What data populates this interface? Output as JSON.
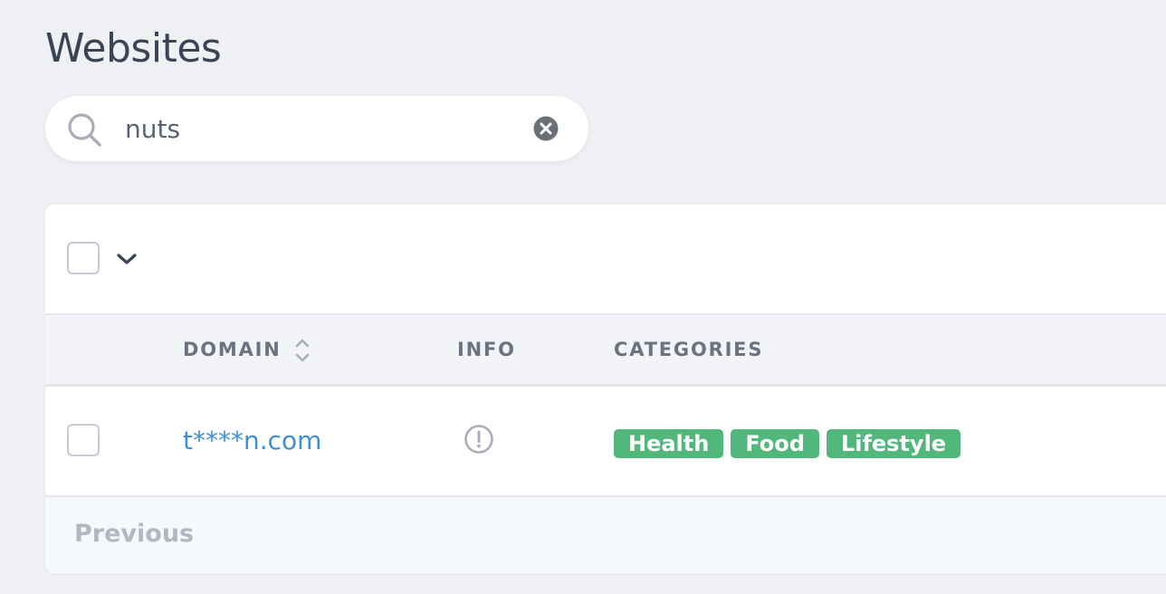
{
  "page": {
    "title": "Websites"
  },
  "search": {
    "value": "nuts",
    "placeholder": "",
    "icon": "search-icon",
    "clear_icon": "clear-icon"
  },
  "table": {
    "toolbar": {
      "select_all_icon": "chevron-down-icon"
    },
    "columns": [
      {
        "label": "DOMAIN",
        "sortable": true
      },
      {
        "label": "INFO"
      },
      {
        "label": "CATEGORIES"
      }
    ],
    "rows": [
      {
        "domain": "t****n.com",
        "info_icon": "alert-circle-icon",
        "categories": [
          "Health",
          "Food",
          "Lifestyle"
        ]
      }
    ],
    "pagination": {
      "previous_label": "Previous"
    }
  },
  "colors": {
    "background": "#eef0f4",
    "link": "#3f8fd8",
    "tag": "#52b77a",
    "heading": "#3a4454",
    "muted": "#6b7280"
  }
}
